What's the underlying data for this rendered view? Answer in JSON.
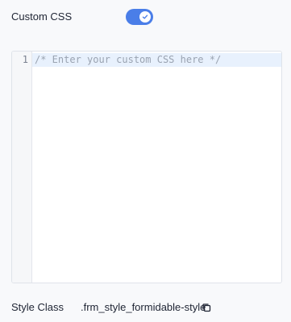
{
  "custom_css": {
    "label": "Custom CSS",
    "toggle_on": true,
    "toggle_color": "#4a7ee8"
  },
  "editor": {
    "line_number": "1",
    "placeholder": "/* Enter your custom CSS here */"
  },
  "style_class": {
    "label": "Style Class",
    "value": ".frm_style_formidable-style",
    "copy_icon": "copy-icon"
  }
}
